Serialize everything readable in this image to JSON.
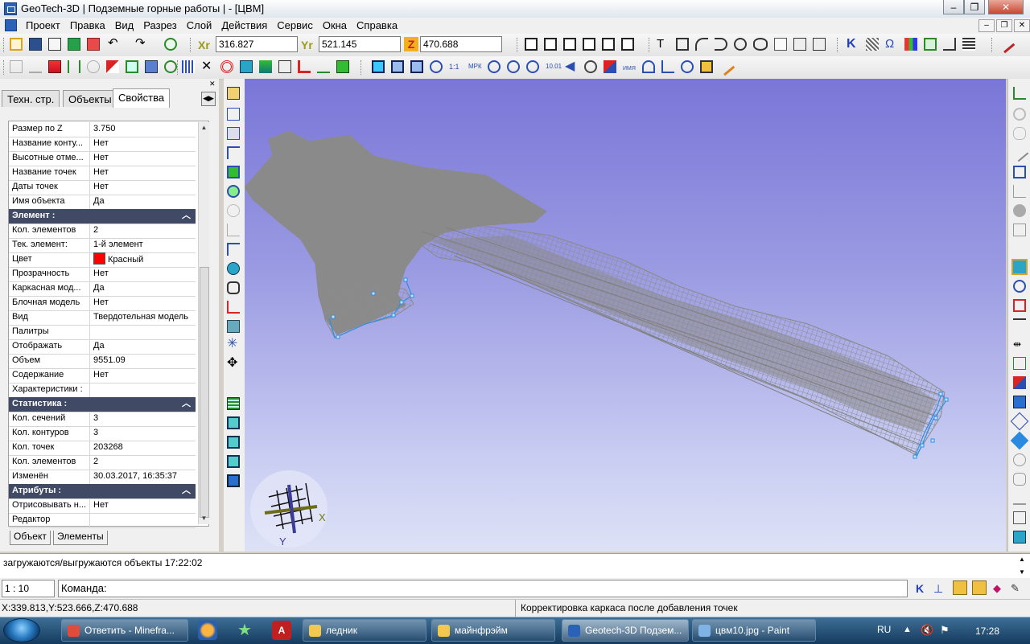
{
  "window": {
    "title": "GeoTech-3D | Подземные горные работы | - [ЦВМ]"
  },
  "menu": [
    "Проект",
    "Правка",
    "Вид",
    "Разрез",
    "Слой",
    "Действия",
    "Сервис",
    "Окна",
    "Справка"
  ],
  "coords": {
    "x_label": "Xr",
    "x_value": "316.827",
    "y_label": "Yr",
    "y_value": "521.145",
    "z_label": "Z",
    "z_value": "470.688"
  },
  "tabs": [
    "Техн. стр.",
    "Объекты",
    "Свойства"
  ],
  "active_tab": "Свойства",
  "properties": [
    {
      "k": "Размер по Z",
      "v": "3.750"
    },
    {
      "k": "Название конту...",
      "v": "Нет"
    },
    {
      "k": "Высотные отме...",
      "v": "Нет"
    },
    {
      "k": "Название точек",
      "v": "Нет"
    },
    {
      "k": "Даты точек",
      "v": "Нет"
    },
    {
      "k": "Имя объекта",
      "v": "Да"
    },
    {
      "k": "Элемент :",
      "group": true
    },
    {
      "k": "Кол. элементов",
      "v": "2"
    },
    {
      "k": "Тек. элемент:",
      "v": "1-й элемент"
    },
    {
      "k": "Цвет",
      "v": "Красный",
      "swatch": "#ff0000"
    },
    {
      "k": "Прозрачность",
      "v": "Нет"
    },
    {
      "k": "Каркасная мод...",
      "v": "Да"
    },
    {
      "k": "Блочная модель",
      "v": "Нет"
    },
    {
      "k": "Вид",
      "v": "Твердотельная модель"
    },
    {
      "k": "Палитры",
      "v": ""
    },
    {
      "k": "Отображать",
      "v": "Да"
    },
    {
      "k": "Объем",
      "v": "9551.09"
    },
    {
      "k": "Содержание",
      "v": "Нет"
    },
    {
      "k": "Характеристики :",
      "v": ""
    },
    {
      "k": "Статистика :",
      "group": true
    },
    {
      "k": "Кол. сечений",
      "v": "3"
    },
    {
      "k": "Кол. контуров",
      "v": "3"
    },
    {
      "k": "Кол. точек",
      "v": "203268"
    },
    {
      "k": "Кол. элементов",
      "v": "2"
    },
    {
      "k": "Изменён",
      "v": "30.03.2017, 16:35:37"
    },
    {
      "k": "Атрибуты :",
      "group": true
    },
    {
      "k": "Отрисовывать н...",
      "v": "Нет"
    },
    {
      "k": "Редактор",
      "v": ""
    }
  ],
  "bottom_tabs": [
    "Объект",
    "Элементы"
  ],
  "axis": {
    "x": "X",
    "y": "Y"
  },
  "log_text": "загружаются/выгружаются объекты 17:22:02",
  "scale": "1 : 10",
  "command_label": "Команда:",
  "status": {
    "coords": "X:339.813,Y:523.666,Z:470.688",
    "message": "Корректировка каркаса после добавления точек"
  },
  "taskbar": {
    "items": [
      {
        "label": "Ответить - Minefra...",
        "icon": "chrome-icon",
        "color": "#e04b3a"
      },
      {
        "label": "ледник",
        "icon": "folder-icon",
        "color": "#f2c94c"
      },
      {
        "label": "майнфрэйм",
        "icon": "folder-icon",
        "color": "#f2c94c"
      },
      {
        "label": "Geotech-3D Подзем...",
        "icon": "geotech-icon",
        "color": "#2a62b8",
        "active": true
      },
      {
        "label": "цвм10.jpg - Paint",
        "icon": "paint-icon",
        "color": "#7fb2e5"
      }
    ],
    "lang": "RU",
    "time": "17:28"
  },
  "colors": {
    "accent": "#2a62b8",
    "group_header": "#404a64",
    "viewport_top": "#7a76d8",
    "mesh": "#8a8a8a",
    "selection": "#2f8fe0"
  }
}
